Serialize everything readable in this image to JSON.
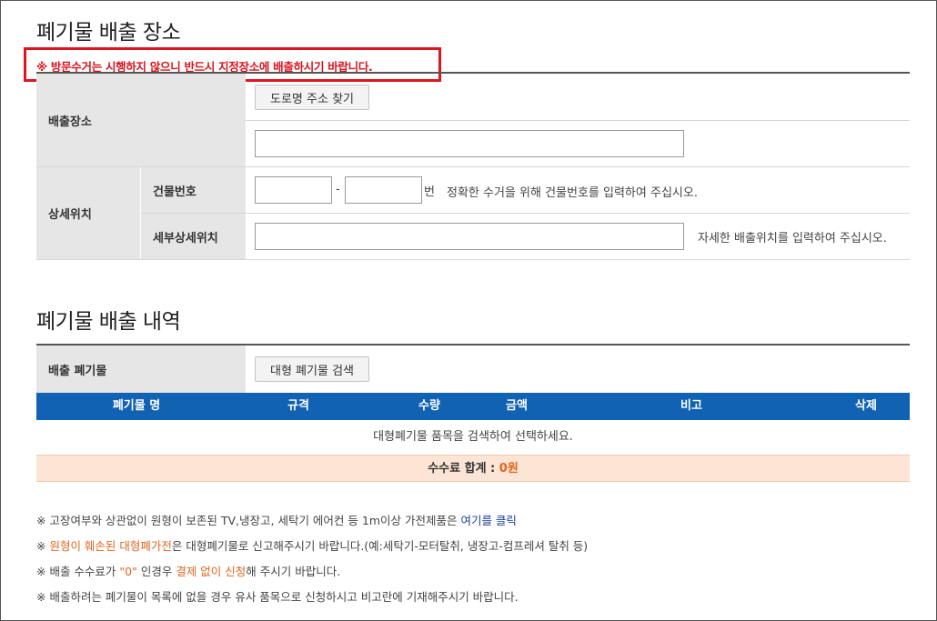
{
  "section1": {
    "title": "폐기물 배출 장소",
    "notice": "※ 방문수거는 시행하지 않으니 반드시 지정장소에 배출하시기 바랍니다.",
    "location_label": "배출장소",
    "road_button": "도로명 주소 찾기",
    "address_value": "",
    "detail_label": "상세위치",
    "building_label": "건물번호",
    "building_main_value": "",
    "building_sub_value": "",
    "dash": "-",
    "beon": "번",
    "building_hint": "정확한 수거을 위해 건물번호를 입력하여 주십시오.",
    "subdetail_label": "세부상세위치",
    "subdetail_value": "",
    "subdetail_hint": "자세한 배출위치를 입력하여 주십시오."
  },
  "section2": {
    "title": "폐기물 배출 내역",
    "waste_label": "배출 폐기물",
    "search_button": "대형 폐기물 검색",
    "columns": [
      "폐기물 명",
      "규격",
      "수량",
      "금액",
      "비고",
      "삭제"
    ],
    "empty_message": "대형폐기물 품목을 검색하여 선택하세요.",
    "total_label": "수수료 합계 : ",
    "total_amount": "0원"
  },
  "notes": {
    "n1_prefix": "※ 고장여부와 상관없이 원형이 보존된 TV,냉장고, 세탁기 에어컨 등 1m이상 가전제품은 ",
    "n1_link": "여기를 클릭",
    "n2_prefix": "※ ",
    "n2_hl1": "원형이 훼손된 대형폐가전",
    "n2_suffix": "은 대형폐기물로 신고해주시기 바랍니다.(예:세탁기-모터탈취, 냉장고-컴프레셔 탈취 등)",
    "n3_prefix": "※ 배출 수수료가 ",
    "n3_zero": "\"0\"",
    "n3_mid": " 인경우 ",
    "n3_hl": "결제 없이 신청",
    "n3_suffix": "해 주시기 바랍니다.",
    "n4": "※ 배출하려는 폐기물이 목록에 없을 경우 유사 품목으로 신청하시고 비고란에 기재해주시기 바랍니다."
  }
}
